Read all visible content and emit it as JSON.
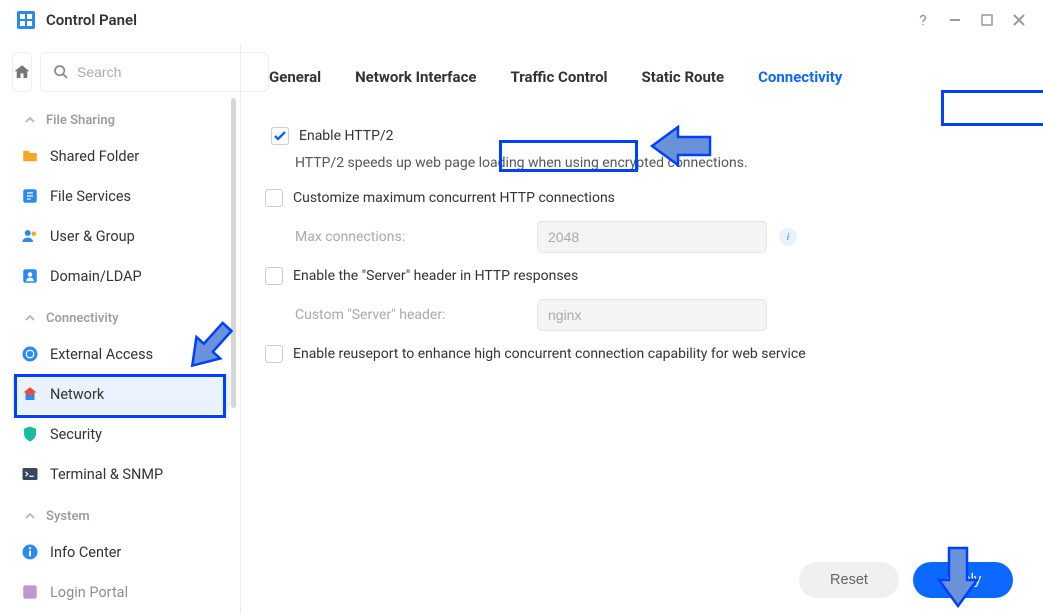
{
  "app": {
    "title": "Control Panel"
  },
  "search": {
    "placeholder": "Search"
  },
  "sidebar": {
    "sections": [
      {
        "title": "File Sharing",
        "items": [
          {
            "label": "Shared Folder"
          },
          {
            "label": "File Services"
          },
          {
            "label": "User & Group"
          },
          {
            "label": "Domain/LDAP"
          }
        ]
      },
      {
        "title": "Connectivity",
        "items": [
          {
            "label": "External Access"
          },
          {
            "label": "Network"
          },
          {
            "label": "Security"
          },
          {
            "label": "Terminal & SNMP"
          }
        ]
      },
      {
        "title": "System",
        "items": [
          {
            "label": "Info Center"
          },
          {
            "label": "Login Portal"
          }
        ]
      }
    ]
  },
  "tabs": {
    "items": [
      "General",
      "Network Interface",
      "Traffic Control",
      "Static Route",
      "Connectivity"
    ],
    "active": 4
  },
  "content": {
    "enable_http2": {
      "label": "Enable HTTP/2",
      "checked": true
    },
    "http2_help": "HTTP/2 speeds up web page loading when using encrypted connections.",
    "customize_max": {
      "label": "Customize maximum concurrent HTTP connections",
      "checked": false
    },
    "max_conn_label": "Max connections:",
    "max_conn_value": "2048",
    "enable_server_header": {
      "label": "Enable the \"Server\" header in HTTP responses",
      "checked": false
    },
    "custom_server_label": "Custom \"Server\" header:",
    "custom_server_value": "nginx",
    "enable_reuseport": {
      "label": "Enable reuseport to enhance high concurrent connection capability for web service",
      "checked": false
    }
  },
  "footer": {
    "reset": "Reset",
    "apply": "Apply"
  }
}
